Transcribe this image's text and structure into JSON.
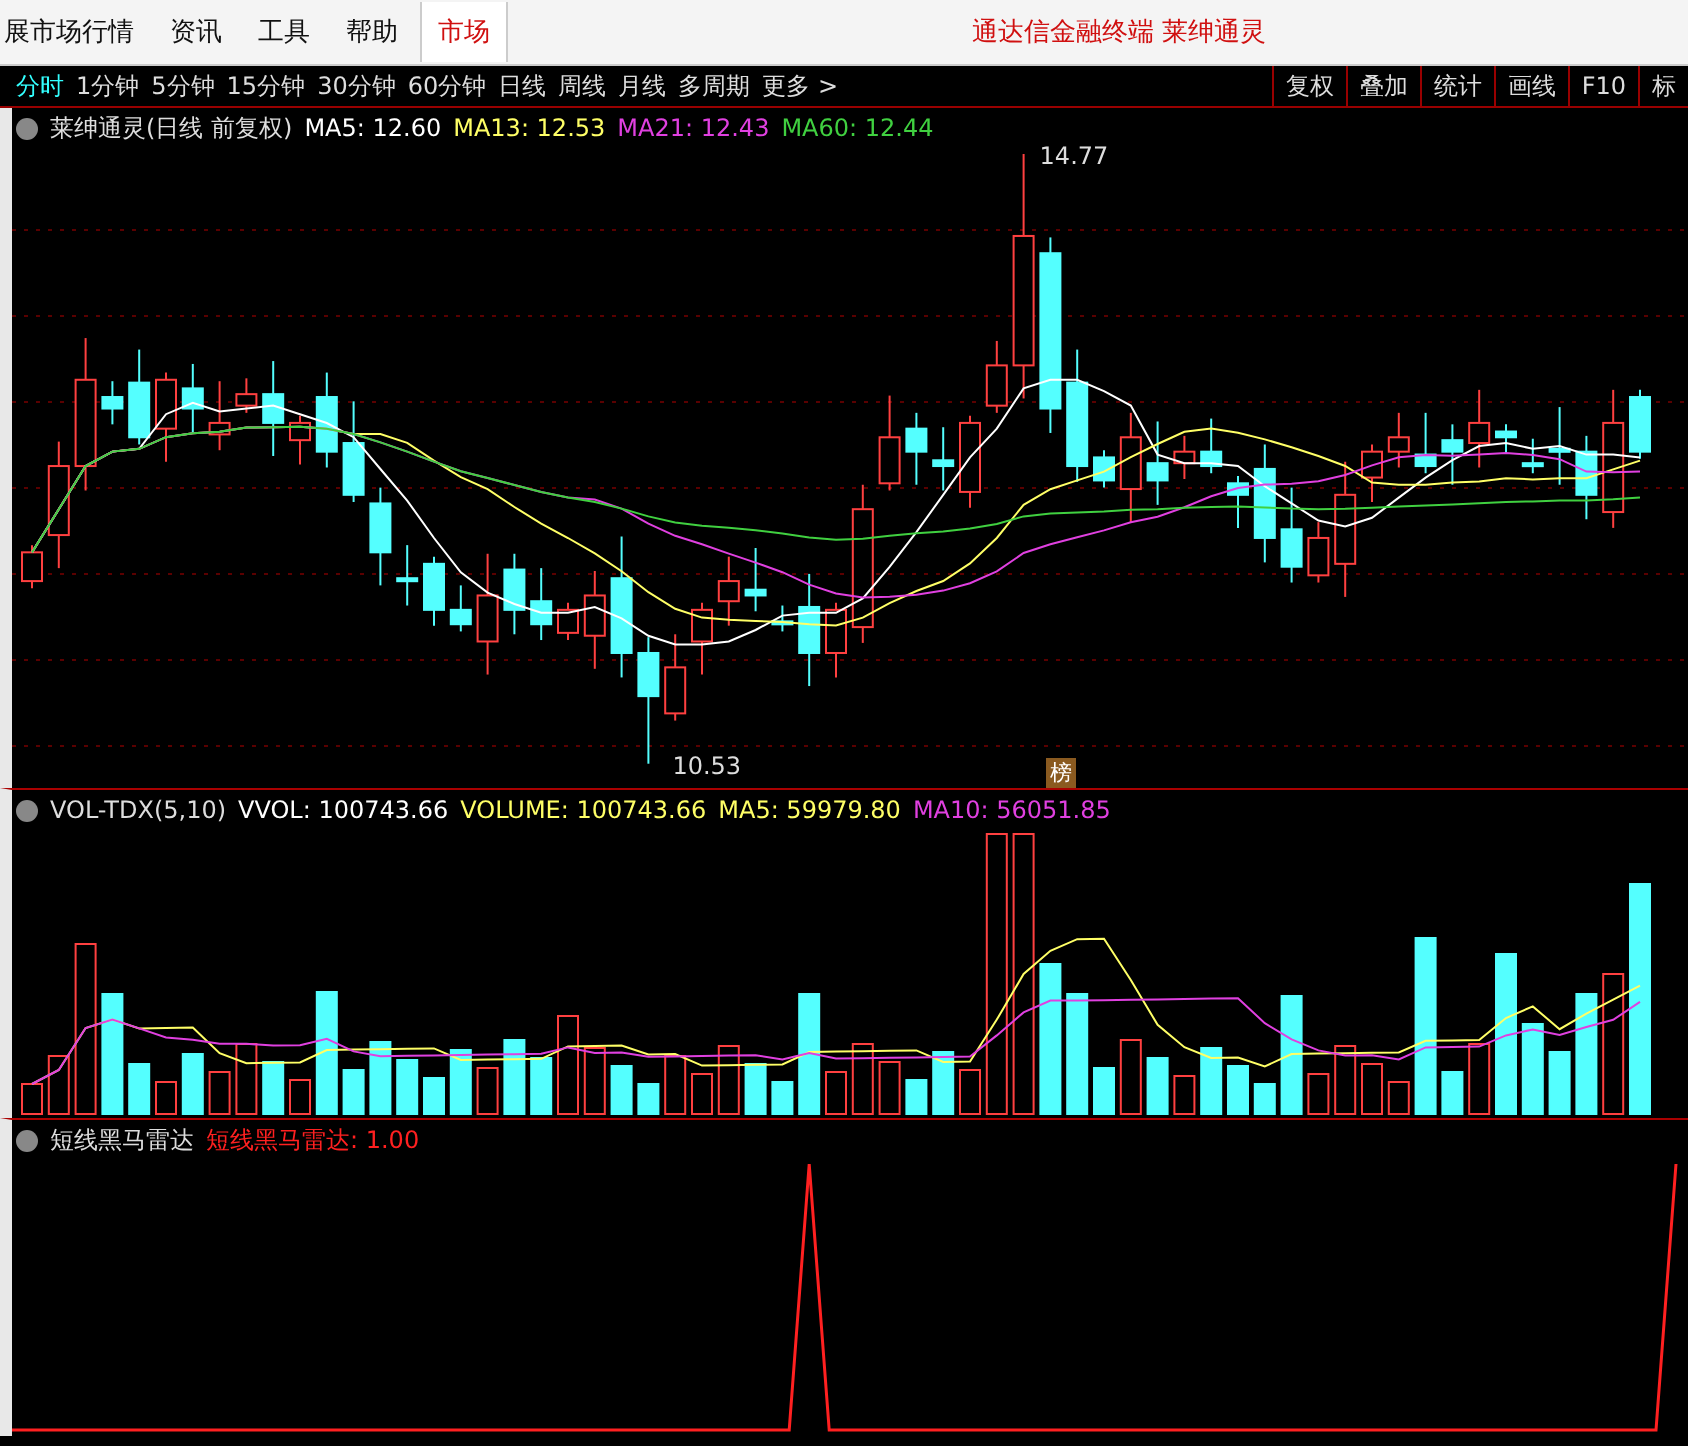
{
  "menu_bar": {
    "items": [
      "展市场行情",
      "资讯",
      "工具",
      "帮助"
    ],
    "tab": {
      "label": "市场",
      "selected": true
    },
    "title": "通达信金融终端 莱绅通灵"
  },
  "period_bar": {
    "periods": [
      {
        "label": "分时",
        "selected": true
      },
      {
        "label": "1分钟",
        "selected": false
      },
      {
        "label": "5分钟",
        "selected": false
      },
      {
        "label": "15分钟",
        "selected": false
      },
      {
        "label": "30分钟",
        "selected": false
      },
      {
        "label": "60分钟",
        "selected": false
      },
      {
        "label": "日线",
        "selected": false
      },
      {
        "label": "周线",
        "selected": false
      },
      {
        "label": "月线",
        "selected": false
      },
      {
        "label": "多周期",
        "selected": false
      },
      {
        "label": "更多 >",
        "selected": false
      }
    ],
    "tools": [
      "复权",
      "叠加",
      "统计",
      "画线",
      "F10",
      "标"
    ]
  },
  "price_panel": {
    "title": "莱绅通灵(日线 前复权)",
    "indicators": [
      {
        "label": "MA5: 12.60",
        "color": "#ffffff"
      },
      {
        "label": "MA13: 12.53",
        "color": "#ffff66"
      },
      {
        "label": "MA21: 12.43",
        "color": "#e040e0"
      },
      {
        "label": "MA60: 12.44",
        "color": "#40d040"
      }
    ],
    "high_label": "14.77",
    "low_label": "10.53",
    "badge": "榜"
  },
  "volume_panel": {
    "title": "VOL-TDX(5,10)",
    "indicators": [
      {
        "label": "VVOL: 100743.66",
        "color": "#ffffff"
      },
      {
        "label": "VOLUME: 100743.66",
        "color": "#ffff66"
      },
      {
        "label": "MA5: 59979.80",
        "color": "#ffff66"
      },
      {
        "label": "MA10: 56051.85",
        "color": "#e040e0"
      }
    ]
  },
  "signal_panel": {
    "title": "短线黑马雷达",
    "indicators": [
      {
        "label": "短线黑马雷达: 1.00",
        "color": "#ff2020"
      }
    ]
  }
}
